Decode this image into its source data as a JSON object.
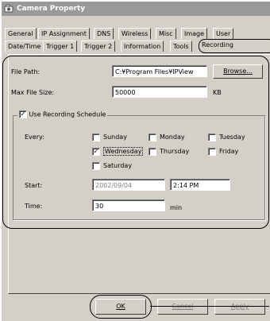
{
  "window": {
    "title": "Camera Property"
  },
  "tabs_row1": [
    "General",
    "IP Assignment",
    "DNS",
    "Wireless",
    "Misc",
    "Image",
    "User"
  ],
  "tabs_row2": [
    "Date/Time",
    "Trigger 1",
    "Trigger 2",
    "Information",
    "Tools",
    "Recording"
  ],
  "form": {
    "file_path_label": "File Path:",
    "file_path_value": "C:¥Program Files¥IPView",
    "browse_label": "Browse...",
    "max_size_label": "Max File Size:",
    "max_size_value": "50000",
    "max_size_unit": "KB"
  },
  "schedule": {
    "use_label": "Use Recording Schedule",
    "use_checked": true,
    "every_label": "Every:",
    "days": [
      {
        "label": "Sunday",
        "checked": false
      },
      {
        "label": "Monday",
        "checked": false
      },
      {
        "label": "Tuesday",
        "checked": false
      },
      {
        "label": "Wednesday",
        "checked": true
      },
      {
        "label": "Thursday",
        "checked": false
      },
      {
        "label": "Friday",
        "checked": false
      },
      {
        "label": "Saturday",
        "checked": false
      }
    ],
    "start_label": "Start:",
    "start_date": "2002/09/04",
    "start_time": "2:14 PM",
    "time_label": "Time:",
    "time_value": "30",
    "time_unit": "min"
  },
  "buttons": {
    "ok": "OK",
    "cancel": "Cancel",
    "apply": "Apply"
  }
}
